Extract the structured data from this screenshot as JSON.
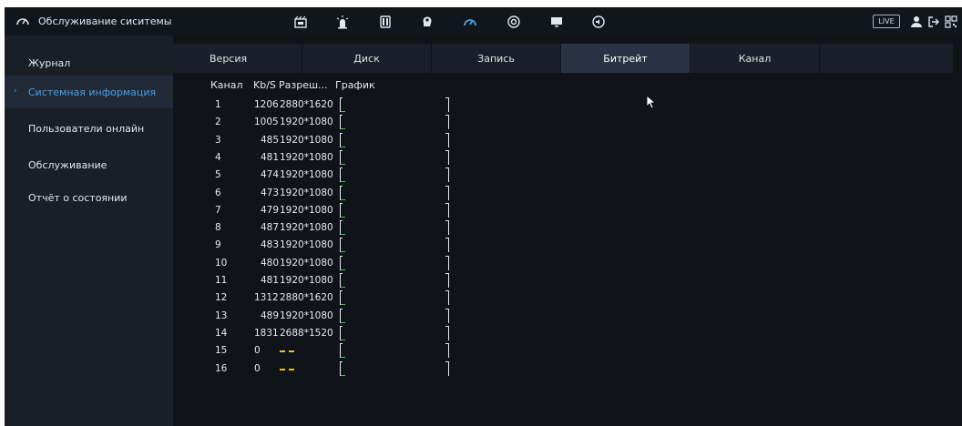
{
  "app": {
    "title": "Обслуживание сиситемы",
    "live_label": "LIVE",
    "top_icons": [
      "film-icon",
      "alarm-icon",
      "storage-icon",
      "ai-icon",
      "maintenance-icon",
      "backup-icon",
      "display-icon",
      "audio-icon"
    ],
    "accent_color": "#3ea3ee"
  },
  "sidebar": {
    "items": [
      {
        "label": "Журнал",
        "active": false
      },
      {
        "label": "Системная информация",
        "active": true
      },
      {
        "label": "Пользователи онлайн",
        "active": false
      },
      {
        "label": "Обслуживание",
        "active": false
      },
      {
        "label": "Отчёт о состоянии",
        "active": false
      }
    ]
  },
  "tabs": {
    "items": [
      {
        "label": "Версия",
        "active": false
      },
      {
        "label": "Диск",
        "active": false
      },
      {
        "label": "Запись",
        "active": false
      },
      {
        "label": "Битрейт",
        "active": true
      },
      {
        "label": "Канал",
        "active": false
      }
    ]
  },
  "table": {
    "headers": {
      "channel": "Канал",
      "kbs": "Kb/S",
      "resolution": "Разреш...",
      "graph": "График"
    },
    "rows": [
      {
        "channel": "1",
        "kbs": "1206",
        "resolution": "2880*1620",
        "has_signal": true
      },
      {
        "channel": "2",
        "kbs": "1005",
        "resolution": "1920*1080",
        "has_signal": true
      },
      {
        "channel": "3",
        "kbs": "485",
        "resolution": "1920*1080",
        "has_signal": true
      },
      {
        "channel": "4",
        "kbs": "481",
        "resolution": "1920*1080",
        "has_signal": true
      },
      {
        "channel": "5",
        "kbs": "474",
        "resolution": "1920*1080",
        "has_signal": true
      },
      {
        "channel": "6",
        "kbs": "473",
        "resolution": "1920*1080",
        "has_signal": true
      },
      {
        "channel": "7",
        "kbs": "479",
        "resolution": "1920*1080",
        "has_signal": true
      },
      {
        "channel": "8",
        "kbs": "487",
        "resolution": "1920*1080",
        "has_signal": true
      },
      {
        "channel": "9",
        "kbs": "483",
        "resolution": "1920*1080",
        "has_signal": true
      },
      {
        "channel": "10",
        "kbs": "480",
        "resolution": "1920*1080",
        "has_signal": true
      },
      {
        "channel": "11",
        "kbs": "481",
        "resolution": "1920*1080",
        "has_signal": true
      },
      {
        "channel": "12",
        "kbs": "1312",
        "resolution": "2880*1620",
        "has_signal": true
      },
      {
        "channel": "13",
        "kbs": "489",
        "resolution": "1920*1080",
        "has_signal": true
      },
      {
        "channel": "14",
        "kbs": "1831",
        "resolution": "2688*1520",
        "has_signal": true
      },
      {
        "channel": "15",
        "kbs": "0",
        "resolution": "",
        "has_signal": false
      },
      {
        "channel": "16",
        "kbs": "0",
        "resolution": "",
        "has_signal": false
      }
    ]
  }
}
